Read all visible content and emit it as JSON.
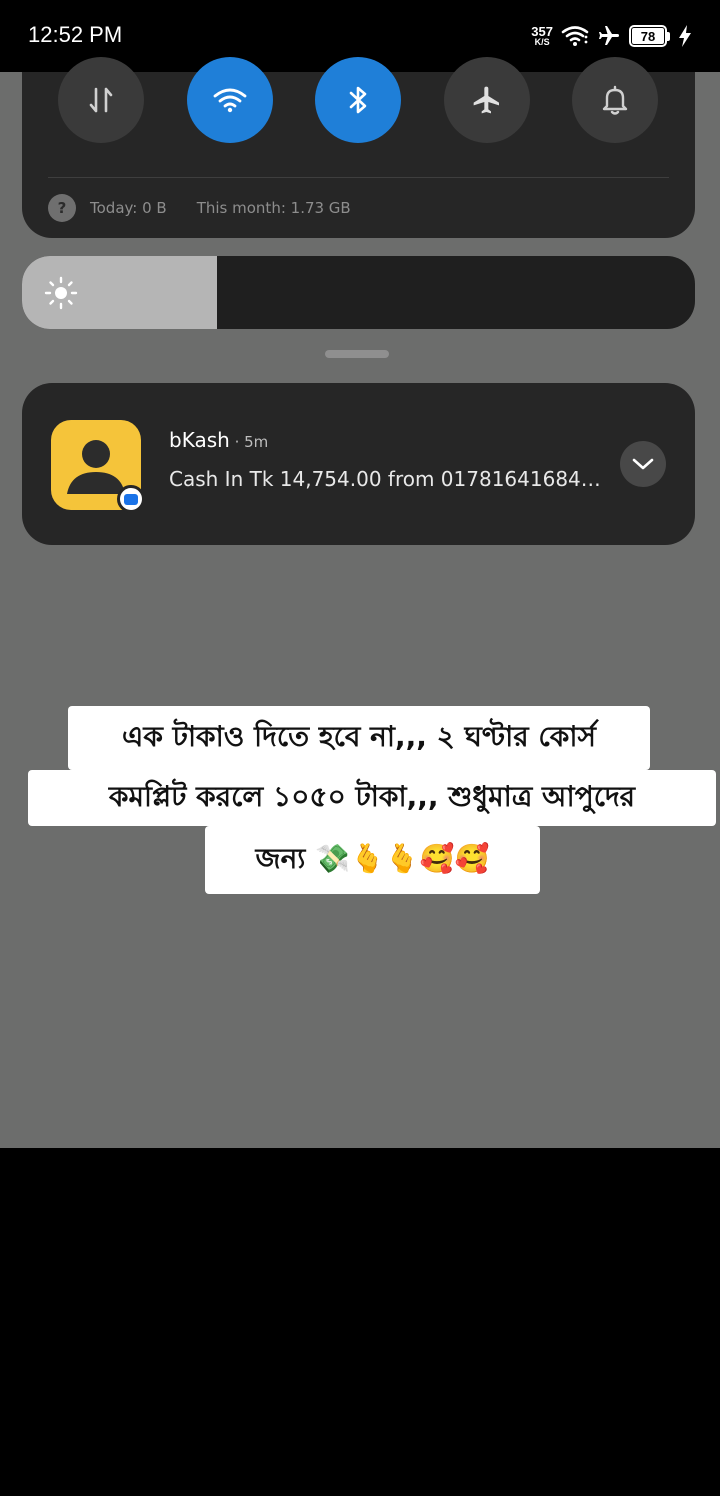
{
  "status_bar": {
    "time": "12:52 PM",
    "net_speed_value": "357",
    "net_speed_unit": "K/S",
    "battery_percent": "78",
    "icons": [
      "wifi-icon",
      "airplane-mode-icon",
      "battery-icon",
      "charging-icon"
    ]
  },
  "quick_settings": {
    "toggles": [
      {
        "name": "mobile-data",
        "icon": "data-arrows-icon",
        "active": false
      },
      {
        "name": "wifi",
        "icon": "wifi-icon",
        "active": true
      },
      {
        "name": "bluetooth",
        "icon": "bluetooth-icon",
        "active": true
      },
      {
        "name": "airplane-mode",
        "icon": "airplane-icon",
        "active": false
      },
      {
        "name": "sound",
        "icon": "bell-icon",
        "active": false
      }
    ],
    "usage_today": "Today: 0 B",
    "usage_month": "This month: 1.73 GB",
    "help_glyph": "?"
  },
  "brightness": {
    "level": 0.29,
    "icon": "sun-icon"
  },
  "notification": {
    "app_name": "bKash",
    "time": " · 5m",
    "text": "Cash In Tk 14,754.00 from 01781641684…",
    "icon": "bkash-profile-icon",
    "badge_icon": "message-bubble-icon",
    "expand_icon": "chevron-down-icon"
  },
  "caption": {
    "line1": "এক টাকাও দিতে হবে না,,, ২ ঘণ্টার কোর্স",
    "line2": "কমপ্লিট করলে ১০৫০ টাকা,,, শুধুমাত্র আপুদের",
    "line3": "জন্য 💸🫰🫰🥰🥰"
  },
  "colors": {
    "shade_background": "#6c6d6c",
    "panel": "#262626",
    "toggle_active": "#1f7fd8",
    "toggle_inactive": "#3a3a3a",
    "bkash_icon": "#f5c43a"
  }
}
